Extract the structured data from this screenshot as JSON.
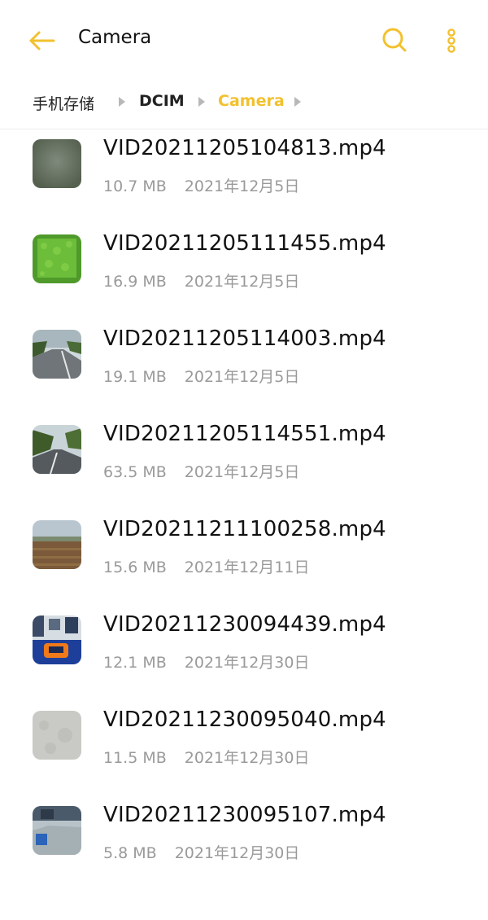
{
  "header": {
    "title": "Camera",
    "accent": "#f2c12e"
  },
  "breadcrumb": {
    "items": [
      "手机存储",
      "DCIM",
      "Camera"
    ]
  },
  "files": [
    {
      "name": "VID20211205104813.mp4",
      "size": "10.7 MB",
      "date": "2021年12月5日"
    },
    {
      "name": "VID20211205111455.mp4",
      "size": "16.9 MB",
      "date": "2021年12月5日"
    },
    {
      "name": "VID20211205114003.mp4",
      "size": "19.1 MB",
      "date": "2021年12月5日"
    },
    {
      "name": "VID20211205114551.mp4",
      "size": "63.5 MB",
      "date": "2021年12月5日"
    },
    {
      "name": "VID20211211100258.mp4",
      "size": "15.6 MB",
      "date": "2021年12月11日"
    },
    {
      "name": "VID20211230094439.mp4",
      "size": "12.1 MB",
      "date": "2021年12月30日"
    },
    {
      "name": "VID20211230095040.mp4",
      "size": "11.5 MB",
      "date": "2021年12月30日"
    },
    {
      "name": "VID20211230095107.mp4",
      "size": "5.8 MB",
      "date": "2021年12月30日"
    }
  ]
}
